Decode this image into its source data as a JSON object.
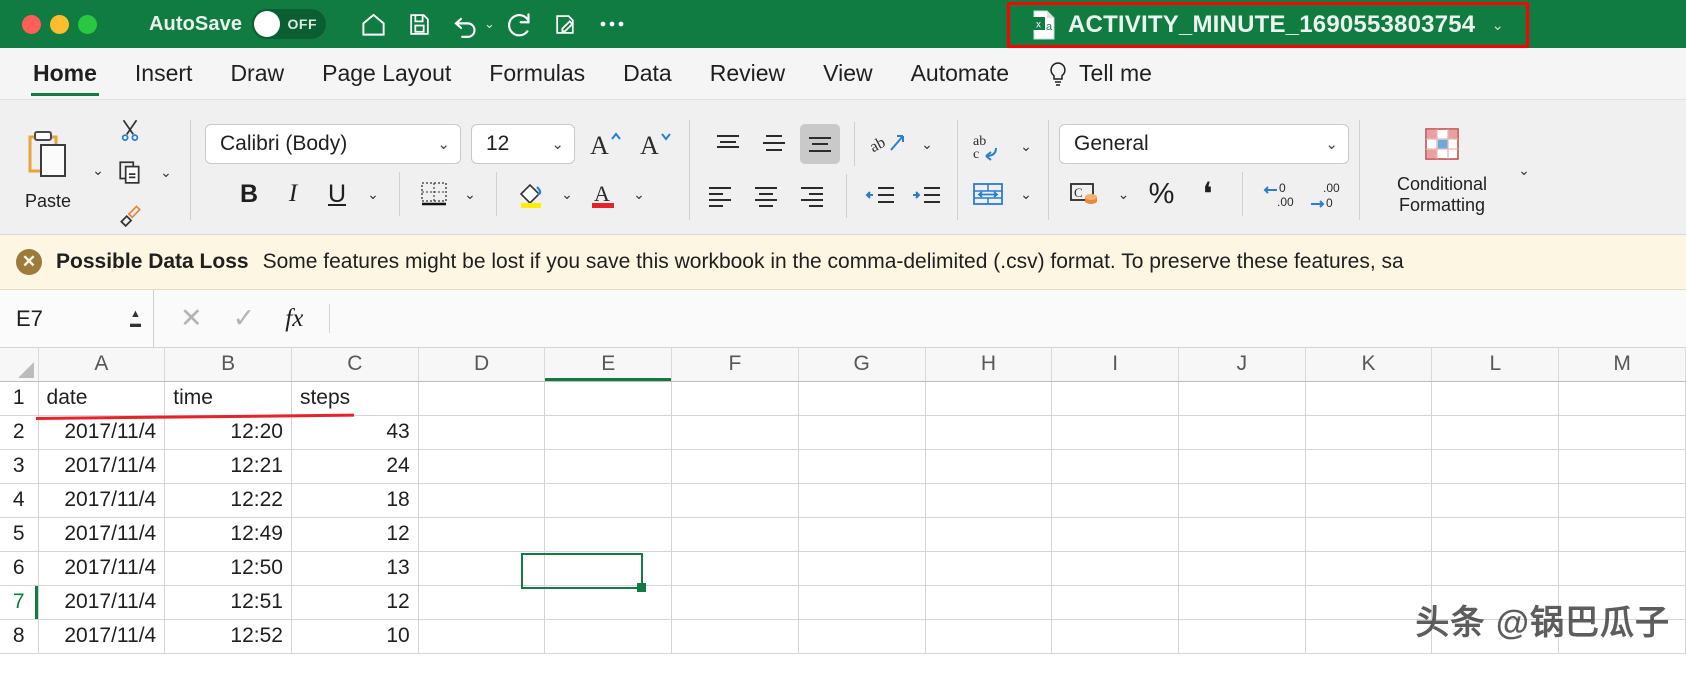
{
  "titlebar": {
    "autosave_label": "AutoSave",
    "autosave_state": "OFF",
    "file_name": "ACTIVITY_MINUTE_1690553803754",
    "file_icon": "excel-file-icon",
    "title_caret": "⌄",
    "quick_access": [
      {
        "name": "home-icon",
        "glyph": "home"
      },
      {
        "name": "save-icon",
        "glyph": "save"
      },
      {
        "name": "undo-icon",
        "glyph": "undo"
      },
      {
        "name": "undo-dropdown-icon",
        "glyph": "⌄"
      },
      {
        "name": "redo-icon",
        "glyph": "redo"
      },
      {
        "name": "quick-print-icon",
        "glyph": "print"
      },
      {
        "name": "more-options-icon",
        "glyph": "•••"
      }
    ],
    "window_controls": [
      "close",
      "minimize",
      "maximize"
    ],
    "annotation_color": "#FF0000"
  },
  "tabs": [
    {
      "label": "Home",
      "active": true
    },
    {
      "label": "Insert",
      "active": false
    },
    {
      "label": "Draw",
      "active": false
    },
    {
      "label": "Page Layout",
      "active": false
    },
    {
      "label": "Formulas",
      "active": false
    },
    {
      "label": "Data",
      "active": false
    },
    {
      "label": "Review",
      "active": false
    },
    {
      "label": "View",
      "active": false
    },
    {
      "label": "Automate",
      "active": false
    },
    {
      "label": "Tell me",
      "active": false,
      "icon": "lightbulb-icon"
    }
  ],
  "ribbon": {
    "paste_label": "Paste",
    "font_name": "Calibri (Body)",
    "font_size": "12",
    "grow_font": "A",
    "shrink_font": "A",
    "bold": "B",
    "italic": "I",
    "underline": "U",
    "number_format": "General",
    "percent": "%",
    "comma": "❟",
    "conditional_formatting_label": "Conditional\nFormatting",
    "conditional_formatting_line1": "Conditional",
    "conditional_formatting_line2": "Formatting",
    "chevron": "⌄"
  },
  "warning": {
    "icon": "close-circle-icon",
    "title": "Possible Data Loss",
    "message": "Some features might be lost if you save this workbook in the comma-delimited (.csv) format. To preserve these features, sa"
  },
  "formula_bar": {
    "name_box_value": "E7",
    "cancel_icon": "✕",
    "confirm_icon": "✓",
    "function_icon": "fx",
    "formula_value": ""
  },
  "sheet": {
    "columns": [
      "A",
      "B",
      "C",
      "D",
      "E",
      "F",
      "G",
      "H",
      "I",
      "J",
      "K",
      "L",
      "M"
    ],
    "selected_column": "E",
    "selected_row": "7",
    "active_cell": "E7",
    "rows": [
      {
        "num": "1",
        "A": "date",
        "B": "time",
        "C": "steps",
        "align": "txt"
      },
      {
        "num": "2",
        "A": "2017/11/4",
        "B": "12:20",
        "C": "43",
        "align": "num"
      },
      {
        "num": "3",
        "A": "2017/11/4",
        "B": "12:21",
        "C": "24",
        "align": "num"
      },
      {
        "num": "4",
        "A": "2017/11/4",
        "B": "12:22",
        "C": "18",
        "align": "num"
      },
      {
        "num": "5",
        "A": "2017/11/4",
        "B": "12:49",
        "C": "12",
        "align": "num"
      },
      {
        "num": "6",
        "A": "2017/11/4",
        "B": "12:50",
        "C": "13",
        "align": "num"
      },
      {
        "num": "7",
        "A": "2017/11/4",
        "B": "12:51",
        "C": "12",
        "align": "num"
      },
      {
        "num": "8",
        "A": "2017/11/4",
        "B": "12:52",
        "C": "10",
        "align": "num"
      }
    ]
  },
  "watermark": "头条 @锅巴瓜子"
}
